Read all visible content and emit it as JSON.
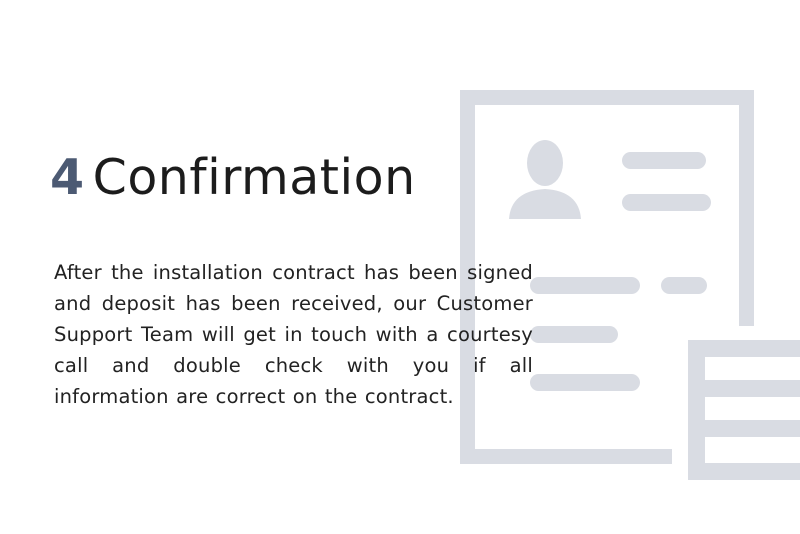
{
  "section": {
    "step_number": "4",
    "title": "Confirmation",
    "description": "After the installation contract has been signed and deposit has been received, our Customer Support Team will get in touch with a courtesy call and double check with you if all information are correct on the contract."
  },
  "illustration": {
    "icon": "contract-document-icon",
    "color": "#d9dce3"
  }
}
